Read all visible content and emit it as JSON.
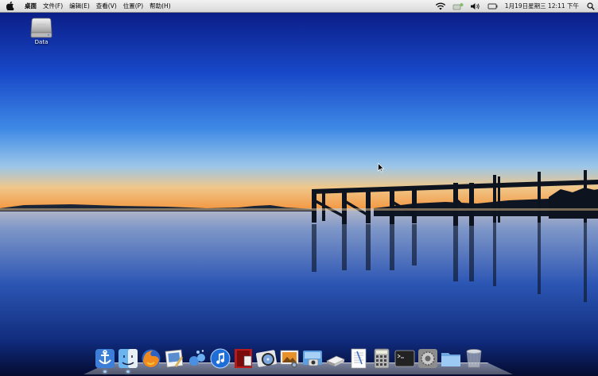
{
  "menubar": {
    "app_name": "桌面",
    "menus": [
      "文件(F)",
      "编辑(E)",
      "查看(V)",
      "位置(P)",
      "帮助(H)"
    ],
    "clock": "1月19日星期三 12:11 下午"
  },
  "desktop": {
    "drive_label": "Data"
  },
  "dock": {
    "items": [
      "anchor-icon",
      "finder-icon",
      "firefox-icon",
      "preview-icon",
      "bubbles-icon",
      "itunes-icon",
      "photo-booth-icon",
      "dvd-player-icon",
      "iphoto-icon",
      "image-capture-icon",
      "scanner-icon",
      "textedit-icon",
      "calculator-icon",
      "terminal-icon",
      "system-preferences-icon",
      "folder-icon",
      "trash-icon"
    ]
  },
  "colors": {
    "sky_top": "#0a1f8c",
    "sky_mid": "#1f5fd6",
    "horizon": "#f0a050",
    "water": "#2a4f9a"
  }
}
